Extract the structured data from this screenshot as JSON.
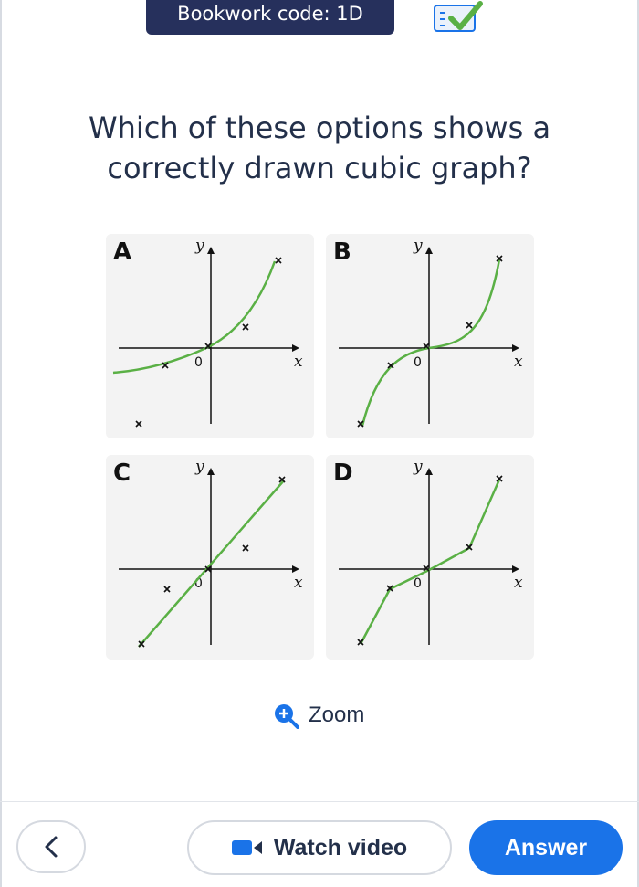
{
  "header": {
    "bookwork_code": "Bookwork code: 1D"
  },
  "question": {
    "line1": "Which of these options shows a",
    "line2": "correctly drawn cubic graph?"
  },
  "axes": {
    "x_label": "x",
    "y_label": "y",
    "origin_label": "0"
  },
  "options": [
    {
      "letter": "A"
    },
    {
      "letter": "B"
    },
    {
      "letter": "C"
    },
    {
      "letter": "D"
    }
  ],
  "zoom": {
    "label": "Zoom"
  },
  "footer": {
    "watch_label": "Watch video",
    "answer_label": "Answer"
  },
  "colors": {
    "banner": "#26305c",
    "curve": "#5ab045",
    "answer_bg": "#1a73e8",
    "zoom_icon": "#1a73e8"
  }
}
